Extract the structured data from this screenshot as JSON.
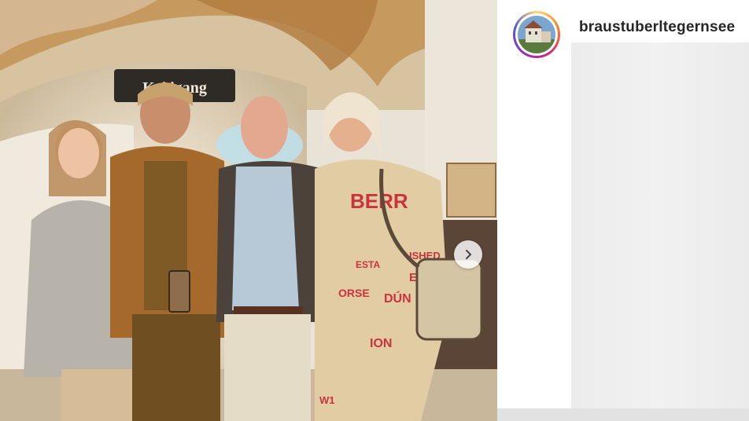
{
  "post": {
    "username": "braustuberltegernsee",
    "photo_sign_text": "Kei   igang"
  },
  "icons": {
    "next": "chevron-right-icon",
    "avatar": "profile-avatar"
  },
  "colors": {
    "username": "#262626",
    "ring_gradient": [
      "#feda75",
      "#fa7e1e",
      "#d62976",
      "#962fbf",
      "#4f5bd5"
    ],
    "placeholder": "#ececec"
  }
}
